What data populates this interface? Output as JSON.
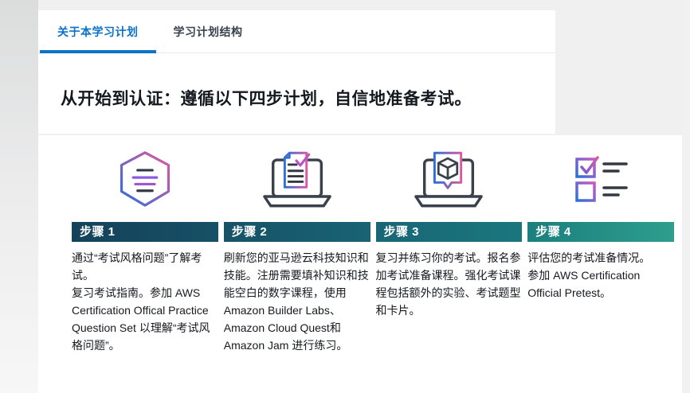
{
  "tabs": [
    {
      "label": "关于本学习计划",
      "active": true
    },
    {
      "label": "学习计划结构",
      "active": false
    }
  ],
  "heading": "从开始到认证：遵循以下四步计划，自信地准备考试。",
  "steps": [
    {
      "title": "步骤 1",
      "icon": "hexagon-document-icon",
      "bar_gradient": [
        "#14425a",
        "#175066"
      ],
      "description": "通过“考试风格问题”了解考试。\n复习考试指南。参加 AWS Certification Offical Practice Question Set 以理解“考试风格问题”。"
    },
    {
      "title": "步骤 2",
      "icon": "laptop-checked-document-icon",
      "bar_gradient": [
        "#175266",
        "#186375"
      ],
      "description": "刷新您的亚马逊云科技知识和技能。注册需要填补知识和技能空白的数字课程，使用 Amazon Builder Labs、Amazon Cloud Quest和Amazon Jam 进行练习。"
    },
    {
      "title": "步骤 3",
      "icon": "laptop-cube-icon",
      "bar_gradient": [
        "#186676",
        "#1a777c"
      ],
      "description": "复习并练习你的考试。报名参加考试准备课程。强化考试课程包括额外的实验、考试题型和卡片。"
    },
    {
      "title": "步骤 4",
      "icon": "checklist-icon",
      "bar_gradient": [
        "#1b7f7e",
        "#2e9e8e"
      ],
      "description": "评估您的考试准备情况。\n参加 AWS Certification Official Pretest。"
    }
  ],
  "colors": {
    "page_background": "#f0f0f1",
    "card_background": "#ffffff",
    "active_tab_blue": "#0b72c8",
    "inactive_tab_text": "#39424e",
    "body_text": "#16191f",
    "icon_gradient_blue": "#2e6fd9",
    "icon_gradient_pink": "#d75aa4",
    "icon_line_dark": "#333943",
    "icon_line_purple": "#8a5ce0"
  }
}
